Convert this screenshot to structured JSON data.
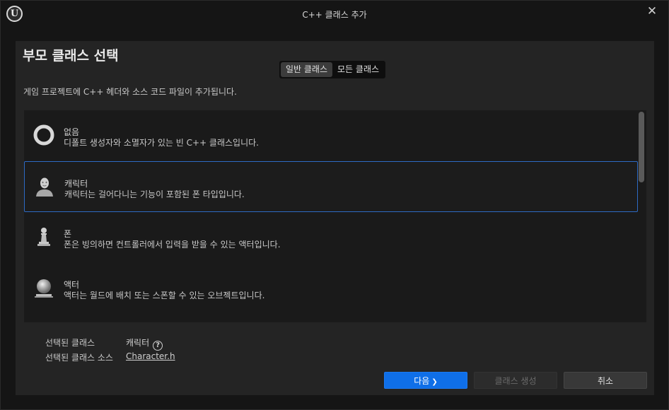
{
  "window": {
    "title": "C++ 클래스 추가"
  },
  "heading": "부모 클래스 선택",
  "tabs": [
    {
      "label": "일반 클래스",
      "active": true
    },
    {
      "label": "모든 클래스",
      "active": false
    }
  ],
  "description": "게임 프로젝트에 C++ 헤더와 소스 코드 파일이 추가됩니다.",
  "classes": [
    {
      "name": "없음",
      "desc": "디폴트 생성자와 소멸자가 있는 빈 C++ 클래스입니다.",
      "icon": "ring-icon"
    },
    {
      "name": "캐릭터",
      "desc": "캐릭터는 걸어다니는 기능이 포함된 폰 타입입니다.",
      "icon": "character-icon",
      "selected": true
    },
    {
      "name": "폰",
      "desc": "폰은 빙의하면 컨트롤러에서 입력을 받을 수 있는 액터입니다.",
      "icon": "pawn-icon"
    },
    {
      "name": "액터",
      "desc": "액터는 월드에 배치 또는 스폰할 수 있는 오브젝트입니다.",
      "icon": "actor-sphere-icon"
    }
  ],
  "info": {
    "selected_class_label": "선택된 클래스",
    "selected_class_value": "캐릭터",
    "selected_source_label": "선택된 클래스 소스",
    "selected_source_value": "Character.h"
  },
  "buttons": {
    "next": "다음",
    "next_glyph": "❯",
    "create": "클래스 생성",
    "cancel": "취소"
  },
  "colors": {
    "accent": "#0f6fe8",
    "selection_border": "#2d6ac4",
    "panel": "#242424",
    "background": "#151515"
  }
}
